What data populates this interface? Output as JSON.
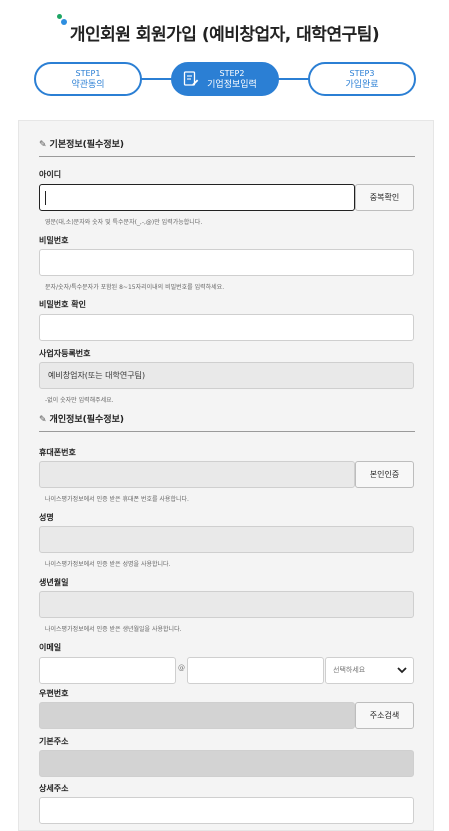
{
  "header": {
    "title": "개인회원 회원가입 (예비창업자, 대학연구팀)"
  },
  "steps": [
    {
      "number": "STEP1",
      "label": "약관동의"
    },
    {
      "number": "STEP2",
      "label": "기업정보입력"
    },
    {
      "number": "STEP3",
      "label": "가입완료"
    }
  ],
  "basic": {
    "heading": "기본정보(필수정보)",
    "id_label": "아이디",
    "id_value": "",
    "dup_check": "중복확인",
    "id_hint": "영문(대,소)문자와 숫자 및 특수문자(_,-,@)만 입력가능합니다.",
    "pw_label": "비밀번호",
    "pw_hint": "문자/숫자/특수문자가 포함된 8~15자리이내의 비밀번호를 입력하세요.",
    "pw_confirm_label": "비밀번호 확인",
    "bizno_label": "사업자등록번호",
    "bizno_value": "예비창업자(또는 대학연구팀)",
    "bizno_hint": "-없이 숫자만 입력해주세요."
  },
  "personal": {
    "heading": "개인정보(필수정보)",
    "phone_label": "휴대폰번호",
    "verify": "본인인증",
    "phone_hint": "나이스평가정보에서 인증 받은 휴대폰 번호를 사용합니다.",
    "name_label": "성명",
    "name_hint": "나이스평가정보에서 인증 받은 성명을 사용합니다.",
    "birth_label": "생년월일",
    "birth_hint": "나이스평가정보에서 인증 받은 생년월일을 사용합니다.",
    "email_label": "이메일",
    "email_at": "@",
    "email_select": "선택하세요",
    "zip_label": "우편번호",
    "addr_search": "주소검색",
    "addr_label": "기본주소",
    "addr_detail_label": "상세주소"
  },
  "colors": {
    "accent": "#2b7fd4",
    "dot_green": "#1ea565",
    "dot_blue": "#2d8ee0"
  },
  "icons": {
    "pencil": "pencil-icon",
    "document": "document-edit-icon",
    "chevron": "chevron-down-icon"
  }
}
